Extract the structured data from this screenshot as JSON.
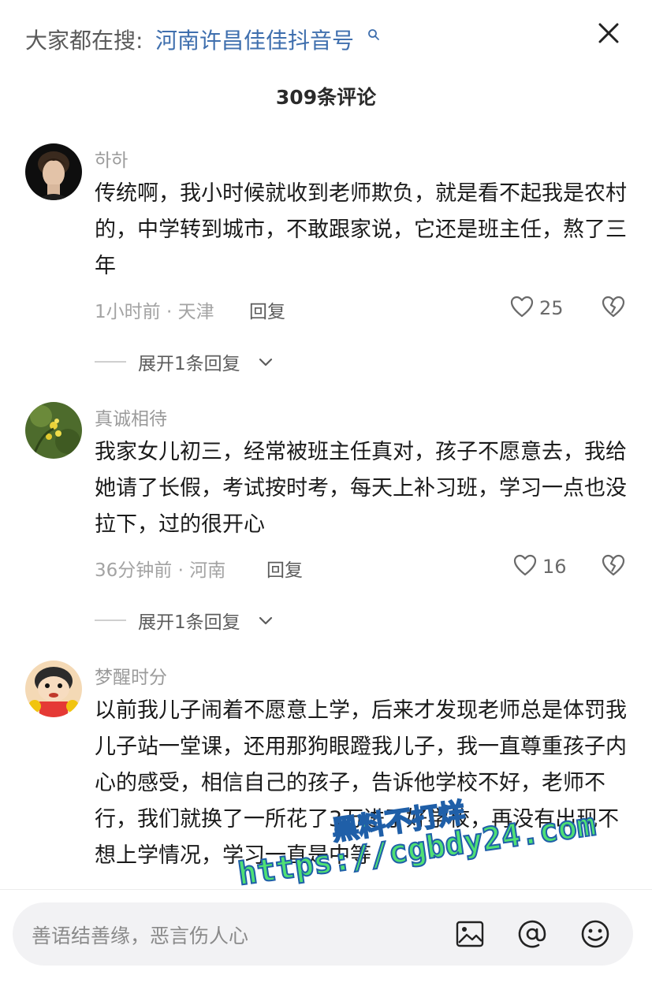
{
  "header": {
    "search_prefix": "大家都在搜:",
    "search_query": "河南许昌佳佳抖音号",
    "close_label": "×"
  },
  "comment_count_title": "309条评论",
  "comments": [
    {
      "username": "하하",
      "text": "传统啊，我小时候就收到老师欺负，就是看不起我是农村的，中学转到城市，不敢跟家说，它还是班主任，熬了三年",
      "time_location": "1小时前 · 天津",
      "reply_label": "回复",
      "likes": "25",
      "expand_label": "展开1条回复"
    },
    {
      "username": "真诚相待",
      "text": "我家女儿初三，经常被班主任真对，孩子不愿意去，我给她请了长假，考试按时考，每天上补习班，学习一点也没拉下，过的很开心",
      "time_location": "36分钟前 · 河南",
      "reply_label": "回复",
      "likes": "16",
      "expand_label": "展开1条回复"
    },
    {
      "username": "梦醒时分",
      "text": "以前我儿子闹着不愿意上学，后来才发现老师总是体罚我儿子站一堂课，还用那狗眼蹬我儿子，我一直尊重孩子内心的感受，相信自己的孩子，告诉他学校不好，老师不行，我们就换了一所花了3万进了好学校，再没有出现不想上学情况，学习一直是中等"
    }
  ],
  "watermark": {
    "line1": "黑料不打烊",
    "line2": "https://cgbdy24.com"
  },
  "composer": {
    "placeholder": "善语结善缘，恶言伤人心"
  },
  "icons": {
    "image": "image-icon",
    "mention": "at-icon",
    "emoji": "emoji-icon",
    "like": "heart-icon",
    "dislike": "broken-heart-icon",
    "search": "search-icon",
    "close": "close-icon",
    "chevron": "chevron-down-icon"
  },
  "colors": {
    "link": "#3f6fae",
    "muted": "#9b9b9b",
    "watermark_fill": "#4fe074",
    "watermark_stroke": "#1f5fa8"
  }
}
